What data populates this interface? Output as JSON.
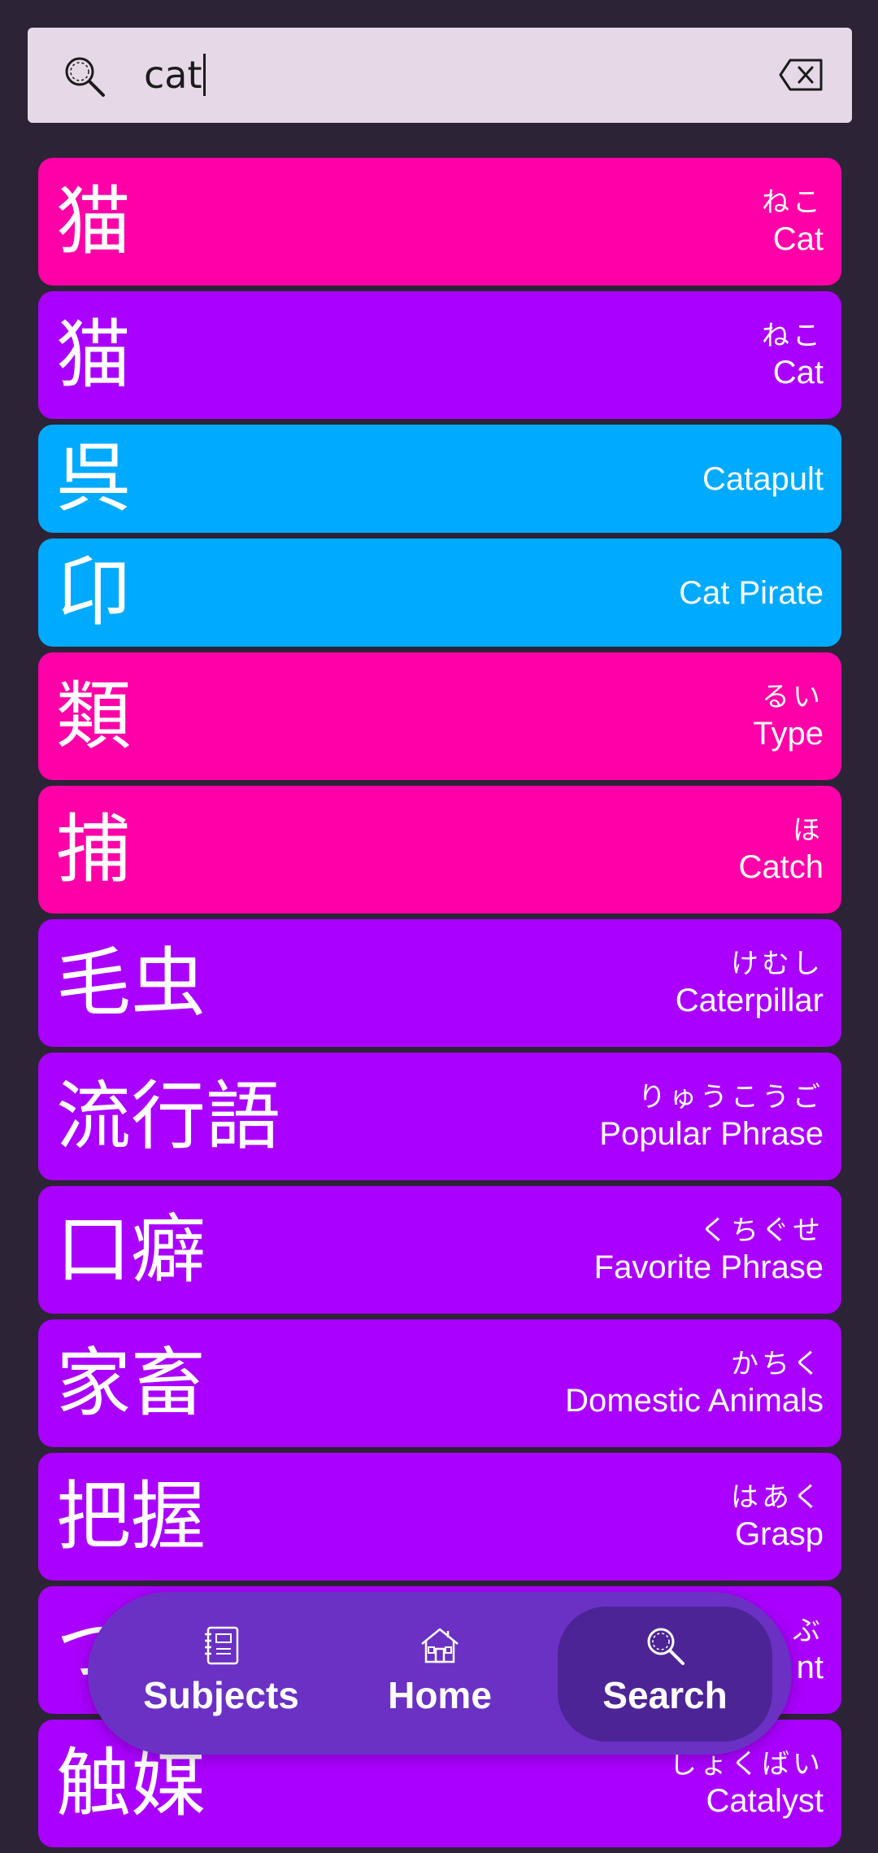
{
  "search": {
    "query": "cat"
  },
  "colors": {
    "background": "#2d2336",
    "search_bg": "#e6d8e6",
    "pink": "#ff00a8",
    "purple": "#aa00ff",
    "blue": "#00aaff",
    "nav_bg": "#6a31c4",
    "nav_active": "#4d2495"
  },
  "results": [
    {
      "kanji": "猫",
      "reading": "ねこ",
      "meaning": "Cat",
      "color": "pink"
    },
    {
      "kanji": "猫",
      "reading": "ねこ",
      "meaning": "Cat",
      "color": "purple"
    },
    {
      "kanji": "呉",
      "reading": "",
      "meaning": "Catapult",
      "color": "blue"
    },
    {
      "kanji": "卬",
      "reading": "",
      "meaning": "Cat Pirate",
      "color": "blue"
    },
    {
      "kanji": "類",
      "reading": "るい",
      "meaning": "Type",
      "color": "pink"
    },
    {
      "kanji": "捕",
      "reading": "ほ",
      "meaning": "Catch",
      "color": "pink"
    },
    {
      "kanji": "毛虫",
      "reading": "けむし",
      "meaning": "Caterpillar",
      "color": "purple"
    },
    {
      "kanji": "流行語",
      "reading": "りゅうこうご",
      "meaning": "Popular Phrase",
      "color": "purple"
    },
    {
      "kanji": "口癖",
      "reading": "くちぐせ",
      "meaning": "Favorite Phrase",
      "color": "purple"
    },
    {
      "kanji": "家畜",
      "reading": "かちく",
      "meaning": "Domestic Animals",
      "color": "purple"
    },
    {
      "kanji": "把握",
      "reading": "はあく",
      "meaning": "Grasp",
      "color": "purple"
    },
    {
      "kanji": "つ",
      "reading": "ぶ",
      "meaning": "nt",
      "color": "purple"
    },
    {
      "kanji": "触媒",
      "reading": "しょくばい",
      "meaning": "Catalyst",
      "color": "purple"
    }
  ],
  "nav": {
    "items": [
      {
        "label": "Subjects",
        "icon": "notebook-icon"
      },
      {
        "label": "Home",
        "icon": "house-icon"
      },
      {
        "label": "Search",
        "icon": "magnifier-icon"
      }
    ],
    "active": "Search"
  }
}
